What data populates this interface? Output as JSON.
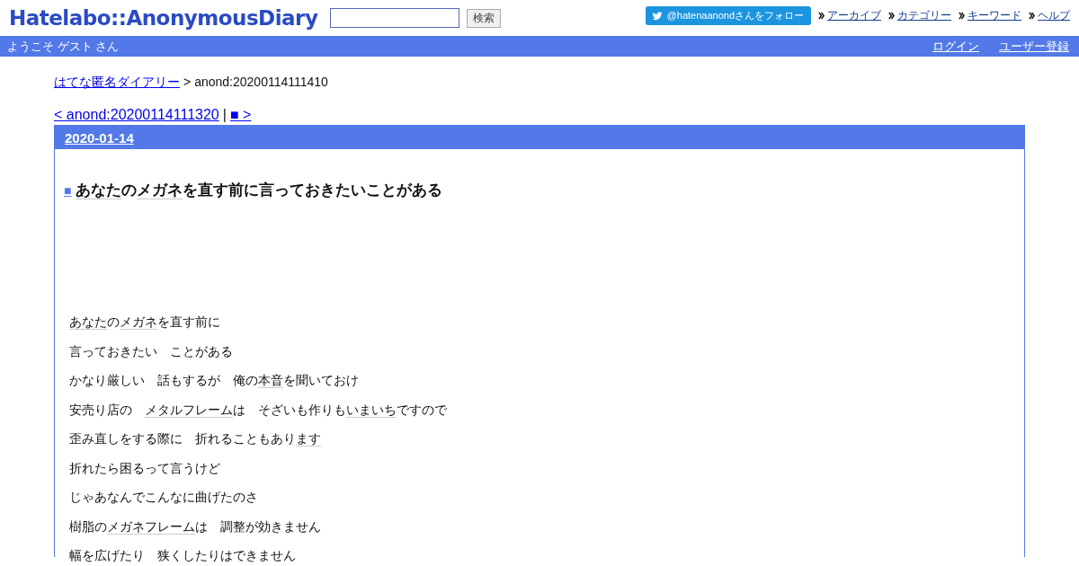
{
  "header": {
    "logo": "Hatelabo::AnonymousDiary",
    "search": {
      "button": "検索"
    },
    "follow_button": "@hatenaanondさんをフォロー",
    "nav": [
      "アーカイブ",
      "カテゴリー",
      "キーワード",
      "ヘルプ"
    ]
  },
  "user_bar": {
    "welcome": "ようこそ ゲスト さん",
    "links": [
      "ログイン",
      "ユーザー登録"
    ]
  },
  "breadcrumb": {
    "home": "はてな匿名ダイアリー",
    "separator": ">",
    "current": "anond:20200114111410"
  },
  "pager": {
    "prev": "< anond:20200114111320",
    "separator": "|",
    "next": "■ >"
  },
  "day": {
    "date": "2020-01-14",
    "entry": {
      "marker": "■",
      "title": [
        {
          "text": "あなた",
          "keyword": true
        },
        {
          "text": "の",
          "keyword": false
        },
        {
          "text": "メガネ",
          "keyword": true
        },
        {
          "text": "を直す前に言っておきたいことがある",
          "keyword": false
        }
      ],
      "paragraphs": [
        [
          {
            "text": "あなた",
            "keyword": true
          },
          {
            "text": "の",
            "keyword": false
          },
          {
            "text": "メガネ",
            "keyword": true
          },
          {
            "text": "を直す前に",
            "keyword": false
          }
        ],
        [
          {
            "text": "言っておきたい　ことがある",
            "keyword": false
          }
        ],
        [
          {
            "text": "かなり厳しい　話もするが　俺の",
            "keyword": false
          },
          {
            "text": "本音",
            "keyword": true
          },
          {
            "text": "を聞いておけ",
            "keyword": false
          }
        ],
        [
          {
            "text": "安売り店の　",
            "keyword": false
          },
          {
            "text": "メタルフレーム",
            "keyword": true
          },
          {
            "text": "は　そざいも作りも",
            "keyword": false
          },
          {
            "text": "いまいち",
            "keyword": true
          },
          {
            "text": "ですので",
            "keyword": false
          }
        ],
        [
          {
            "text": "歪み直しをする際に　折れることもあり",
            "keyword": false
          },
          {
            "text": "ます",
            "keyword": true
          }
        ],
        [
          {
            "text": "折れたら困るって言うけど",
            "keyword": false
          }
        ],
        [
          {
            "text": "じゃあなんでこんなに曲げたのさ",
            "keyword": false
          }
        ],
        [
          {
            "text": "樹脂の",
            "keyword": false
          },
          {
            "text": "メガネフレーム",
            "keyword": true
          },
          {
            "text": "は　調整が効きません",
            "keyword": false
          }
        ],
        [
          {
            "text": "幅を広げたり　狭くしたりはできません",
            "keyword": false
          }
        ]
      ]
    }
  }
}
